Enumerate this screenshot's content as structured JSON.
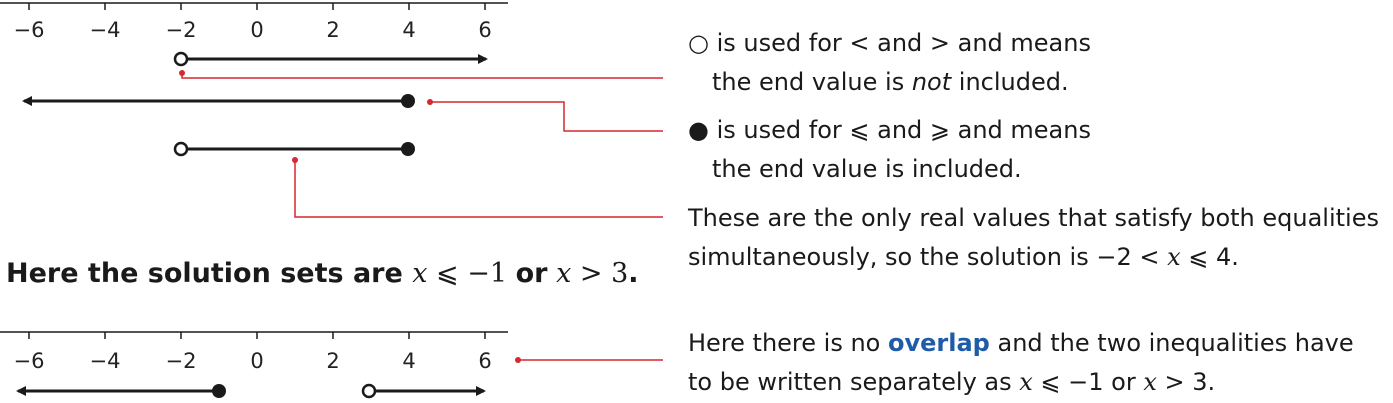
{
  "number_lines": [
    {
      "ticks": [
        "−6",
        "−4",
        "−2",
        "0",
        "2",
        "4",
        "6"
      ],
      "tick_values": [
        -6,
        -4,
        -2,
        0,
        2,
        4,
        6
      ],
      "segments": [
        {
          "from": -2,
          "to": "+inf",
          "from_end": "open"
        },
        {
          "from": "-inf",
          "to": 4,
          "to_end": "closed"
        },
        {
          "from": -2,
          "to": 4,
          "from_end": "open",
          "to_end": "closed"
        }
      ]
    },
    {
      "ticks": [
        "−6",
        "−4",
        "−2",
        "0",
        "2",
        "4",
        "6"
      ],
      "tick_values": [
        -6,
        -4,
        -2,
        0,
        2,
        4,
        6
      ],
      "segments": [
        {
          "from": "-inf",
          "to": -1,
          "to_end": "closed"
        },
        {
          "from": 3,
          "to": "+inf",
          "from_end": "open"
        }
      ]
    }
  ],
  "notes": {
    "open_circle": {
      "symbol": "○",
      "line1_a": "is used for < and > and means",
      "line2_a": "the end value is ",
      "line2_em": "not",
      "line2_b": " included."
    },
    "closed_circle": {
      "symbol": "●",
      "line1": "is used for ⩽ and ⩾ and means",
      "line2": "the end value is included."
    },
    "overlap": {
      "line1": "These are the only real values that satisfy both equalities",
      "line2_a": "simultaneously, so the solution is −2 < ",
      "line2_var": "x",
      "line2_b": " ⩽ 4."
    },
    "no_overlap": {
      "line1_a": "Here there is no ",
      "line1_kw": "overlap",
      "line1_b": " and the two inequalities have",
      "line2_a": "to be written separately as ",
      "line2_var1": "x",
      "line2_b": " ⩽ −1 or ",
      "line2_var2": "x",
      "line2_c": " > 3."
    }
  },
  "heading": {
    "text_a": "Here the solution sets are ",
    "var1": "x",
    "mid1": " ⩽ −1 ",
    "or": "or",
    "var2": "x",
    "mid2": " > 3",
    "end": "."
  },
  "colors": {
    "ink": "#1a1a1a",
    "leader": "#d6282f",
    "keyword": "#1f5ca8"
  }
}
